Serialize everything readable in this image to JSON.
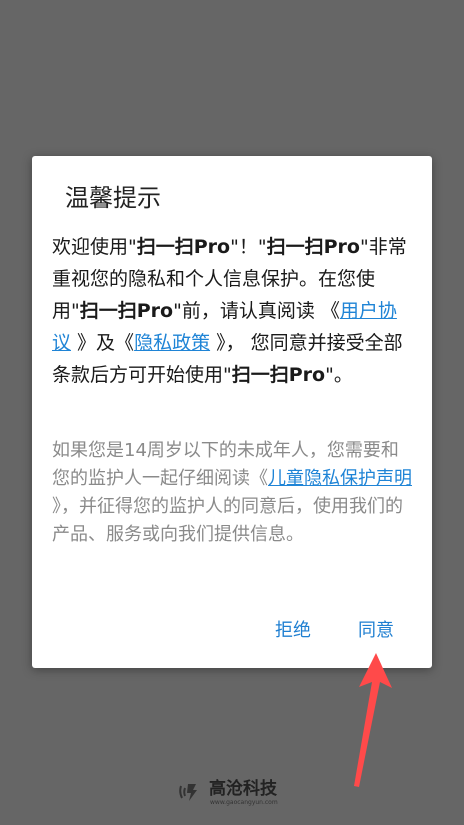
{
  "dialog": {
    "title": "温馨提示",
    "para1": {
      "t1": "欢迎使用\"",
      "app1": "扫一扫Pro",
      "t2": "\"！\"",
      "app2": "扫一扫Pro",
      "t3": "\"非常重视您的隐私和个人信息保护。在您使用\"",
      "app3": "扫一扫Pro",
      "t4": "\"前，请认真阅读 《",
      "link_user_agreement": "用户协议",
      "t5": " 》及《",
      "link_privacy_policy": "隐私政策",
      "t6": " 》， 您同意并接受全部条款后方可开始使用\"",
      "app4": "扫一扫Pro",
      "t7": "\"。"
    },
    "para2": {
      "t1": "如果您是14周岁以下的未成年人，您需要和您的监护人一起仔细阅读《",
      "link_children": "儿童隐私保护声明",
      "t2": " 》，并征得您的监护人的同意后，使用我们的产品、服务或向我们提供信息。"
    },
    "buttons": {
      "reject": "拒绝",
      "agree": "同意"
    }
  },
  "watermark": {
    "name": "高沧科技",
    "url": "www.gaocangyun.com"
  },
  "colors": {
    "overlay": "#666666",
    "link": "#1f84d6",
    "button": "#1f7fd1",
    "annotation_arrow": "#ff4a4a"
  }
}
